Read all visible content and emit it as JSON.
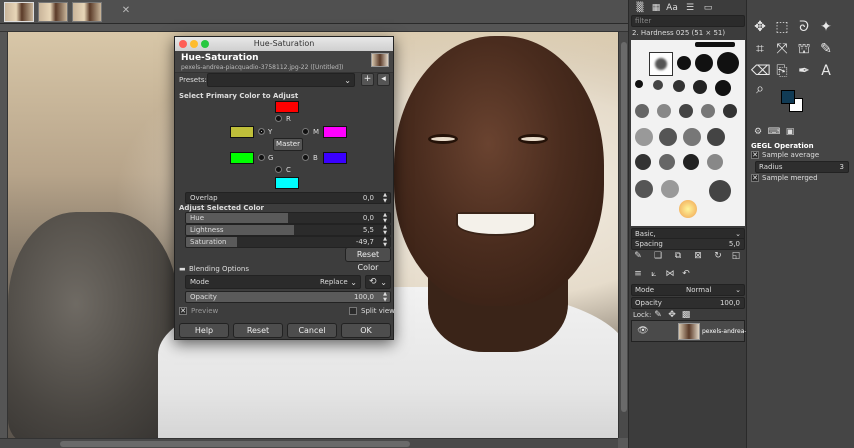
{
  "dialog": {
    "title": "Hue-Saturation",
    "header_name": "Hue-Saturation",
    "header_sub": "pexels-andrea-piacquadio-3758112.jpg-22 ([Untitled])",
    "presets_label": "Presets:",
    "presets_value": "",
    "primary_color_heading": "Select Primary Color to Adjust",
    "colors": {
      "R": {
        "label": "R",
        "hex": "#ff0000"
      },
      "Y": {
        "label": "Y",
        "hex": "#bfbf3a"
      },
      "G": {
        "label": "G",
        "hex": "#00ff00"
      },
      "C": {
        "label": "C",
        "hex": "#00ffff"
      },
      "B": {
        "label": "B",
        "hex": "#3a00ff"
      },
      "M": {
        "label": "M",
        "hex": "#ff00ff"
      }
    },
    "selected_color": "Y",
    "master_label": "Master",
    "overlap": {
      "label": "Overlap",
      "value": "0,0",
      "fraction": 0.0
    },
    "adjust_heading": "Adjust Selected Color",
    "hue": {
      "label": "Hue",
      "value": "0,0",
      "fraction": 0.5
    },
    "lightness": {
      "label": "Lightness",
      "value": "5,5",
      "fraction": 0.53
    },
    "saturation": {
      "label": "Saturation",
      "value": "-49,7",
      "fraction": 0.25
    },
    "reset_color_label": "Reset Color",
    "blending_heading": "Blending Options",
    "mode_label": "Mode",
    "mode_value": "Replace",
    "opacity": {
      "label": "Opacity",
      "value": "100,0",
      "fraction": 1.0
    },
    "preview_label": "Preview",
    "preview_checked": true,
    "split_view_label": "Split view",
    "split_view_checked": false,
    "buttons": {
      "help": "Help",
      "reset": "Reset",
      "cancel": "Cancel",
      "ok": "OK"
    }
  },
  "brushes_panel": {
    "filter_placeholder": "filter",
    "brush_name": "2. Hardness 025 (51 × 51)",
    "preset_value": "Basic,",
    "spacing_label": "Spacing",
    "spacing_value": "5,0"
  },
  "layers_panel": {
    "mode_label": "Mode",
    "mode_value": "Normal",
    "opacity_label": "Opacity",
    "opacity_value": "100,0",
    "lock_label": "Lock:",
    "layer_name": "pexels-andrea-p"
  },
  "tool_options": {
    "title": "GEGL Operation",
    "sample_average": "Sample average",
    "radius_label": "Radius",
    "radius_value": "3",
    "sample_merged": "Sample merged"
  },
  "colors": {
    "foreground": "#113b55",
    "background": "#ffffff",
    "dialog_bg": "#3d3d3d"
  }
}
